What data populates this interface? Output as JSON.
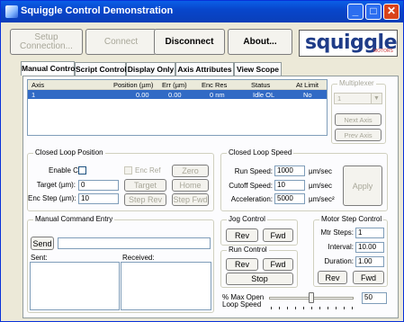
{
  "window": {
    "title": "Squiggle Control Demonstration"
  },
  "top_buttons": {
    "setup": "Setup\nConnection...",
    "connect": "Connect",
    "disconnect": "Disconnect",
    "about": "About..."
  },
  "logo": {
    "text": "squiggle",
    "sub": "MOTORS"
  },
  "tabs": [
    {
      "label": "Manual Control",
      "active": true
    },
    {
      "label": "Script Control",
      "active": false
    },
    {
      "label": "Display Only",
      "active": false
    },
    {
      "label": "Axis Attributes",
      "active": false
    },
    {
      "label": "View Scope",
      "active": false
    }
  ],
  "axis_table": {
    "headers": [
      "Axis",
      "Position (µm)",
      "Err (µm)",
      "Enc Res",
      "Status",
      "At Limit"
    ],
    "rows": [
      [
        "1",
        "0.00",
        "0.00",
        "0 nm",
        "Idle OL",
        "No"
      ]
    ]
  },
  "multiplexer": {
    "title": "Multiplexer",
    "selected": "1",
    "next_axis": "Next Axis",
    "prev_axis": "Prev Axis"
  },
  "closed_loop_position": {
    "title": "Closed Loop Position",
    "enable_cl_label": "Enable CL:",
    "enc_ref_label": "Enc Ref",
    "zero": "Zero",
    "target_label": "Target (µm):",
    "target_value": "0",
    "target_btn": "Target",
    "home_btn": "Home",
    "enc_step_label": "Enc Step (µm):",
    "enc_step_value": "10",
    "step_rev": "Step Rev",
    "step_fwd": "Step Fwd"
  },
  "closed_loop_speed": {
    "title": "Closed Loop Speed",
    "run_speed_label": "Run Speed:",
    "run_speed_value": "1000",
    "run_speed_unit": "µm/sec",
    "cutoff_label": "Cutoff Speed:",
    "cutoff_value": "10",
    "cutoff_unit": "µm/sec",
    "accel_label": "Acceleration:",
    "accel_value": "5000",
    "accel_unit": "µm/sec²",
    "apply": "Apply"
  },
  "manual_command": {
    "title": "Manual Command Entry",
    "send": "Send",
    "input_value": "",
    "sent_label": "Sent:",
    "received_label": "Received:"
  },
  "jog_control": {
    "title": "Jog Control",
    "rev": "Rev",
    "fwd": "Fwd"
  },
  "run_control": {
    "title": "Run Control",
    "rev": "Rev",
    "fwd": "Fwd",
    "stop": "Stop"
  },
  "motor_step_control": {
    "title": "Motor Step Control",
    "mtr_steps_label": "Mtr Steps:",
    "mtr_steps_value": "1",
    "interval_label": "Interval:",
    "interval_value": "10.00",
    "duration_label": "Duration:",
    "duration_value": "1.00",
    "rev": "Rev",
    "fwd": "Fwd"
  },
  "open_loop_speed": {
    "label": "% Max Open\nLoop Speed",
    "value": "50",
    "percent": 50
  }
}
